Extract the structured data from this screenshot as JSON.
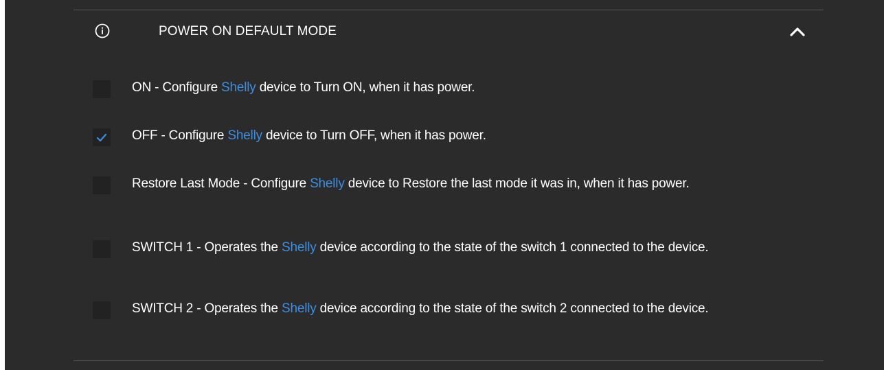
{
  "section": {
    "title": "POWER ON DEFAULT MODE",
    "info_icon": "info-circle-icon",
    "collapse_icon": "chevron-up-icon"
  },
  "colors": {
    "background": "#2b2b2b",
    "text": "#ffffff",
    "brand_link": "#3d8ee0",
    "checkbox_bg": "#222222",
    "divider": "#555555"
  },
  "options": [
    {
      "checked": false,
      "prefix": "ON - Configure ",
      "brand": "Shelly",
      "suffix": " device to Turn ON, when it has power."
    },
    {
      "checked": true,
      "prefix": "OFF - Configure ",
      "brand": "Shelly",
      "suffix": " device to Turn OFF, when it has power."
    },
    {
      "checked": false,
      "prefix": "Restore Last Mode - Configure ",
      "brand": "Shelly",
      "suffix": " device to Restore the last mode it was in, when it has power."
    },
    {
      "checked": false,
      "prefix": "SWITCH 1 - Operates the ",
      "brand": "Shelly",
      "suffix": " device according to the state of the switch 1 connected to the device."
    },
    {
      "checked": false,
      "prefix": "SWITCH 2 - Operates the ",
      "brand": "Shelly",
      "suffix": " device according to the state of the switch 2 connected to the device."
    }
  ]
}
